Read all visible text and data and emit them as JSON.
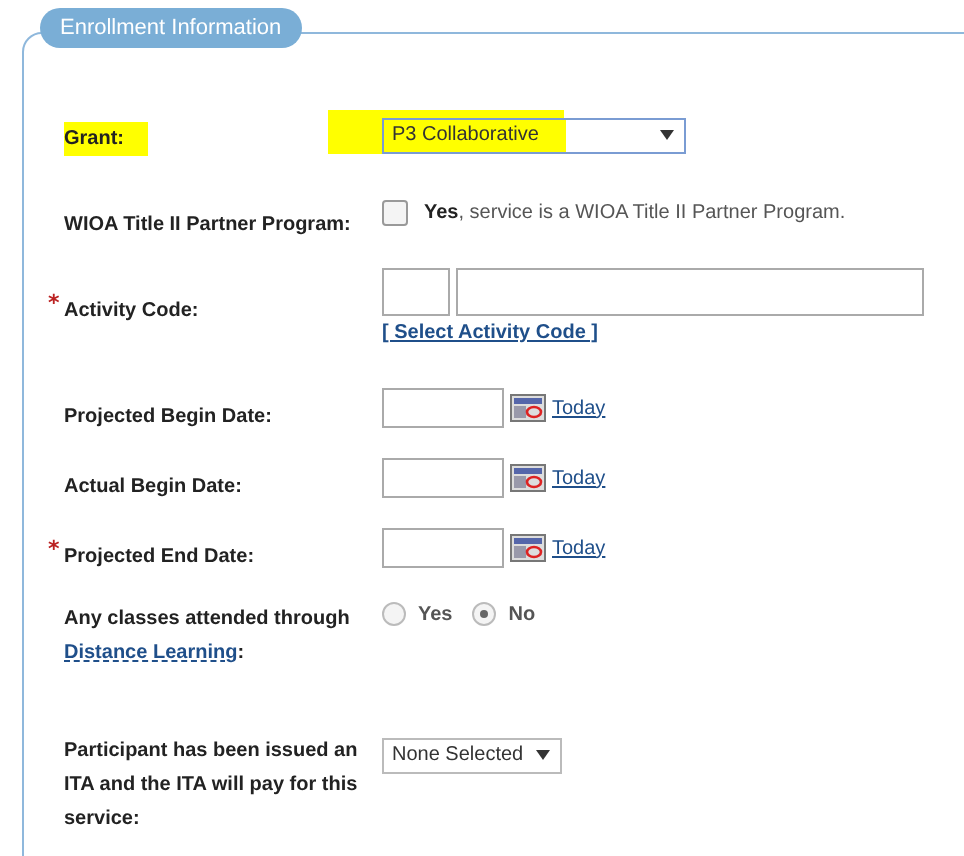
{
  "section": {
    "title": "Enrollment Information"
  },
  "fields": [
    {
      "kind": "select",
      "label": "Grant:",
      "highlighted": true,
      "value": "P3 Collaborative"
    },
    {
      "kind": "checkbox",
      "label": "WIOA Title II Partner Program:",
      "highlighted": false,
      "checked": false,
      "text": "**Yes**, service is a WIOA Title II Partner Program."
    },
    {
      "kind": "activity",
      "marker": "*",
      "label": "Activity Code:",
      "highlighted": false,
      "link": "[ Select Activity Code ]"
    },
    {
      "kind": "date",
      "label": "Projected Begin Date:",
      "highlighted": false,
      "link": "Today"
    },
    {
      "kind": "date",
      "label": "Actual Begin Date:",
      "highlighted": false,
      "link": "Today"
    },
    {
      "kind": "date",
      "marker": "*",
      "label": "Projected End Date:",
      "highlighted": false,
      "link": "Today"
    },
    {
      "kind": "radio",
      "label": "Any classes attended through",
      "label_link": "Distance Learning",
      "label_suffix": ":",
      "highlighted": false,
      "options": [
        {
          "label": "Yes",
          "selected": false
        },
        {
          "label": "No",
          "selected": true
        }
      ]
    },
    {
      "kind": "select",
      "label": "Participant has been issued an ITA and the ITA will pay for this service:",
      "highlighted": false,
      "value": "None Selected"
    }
  ]
}
